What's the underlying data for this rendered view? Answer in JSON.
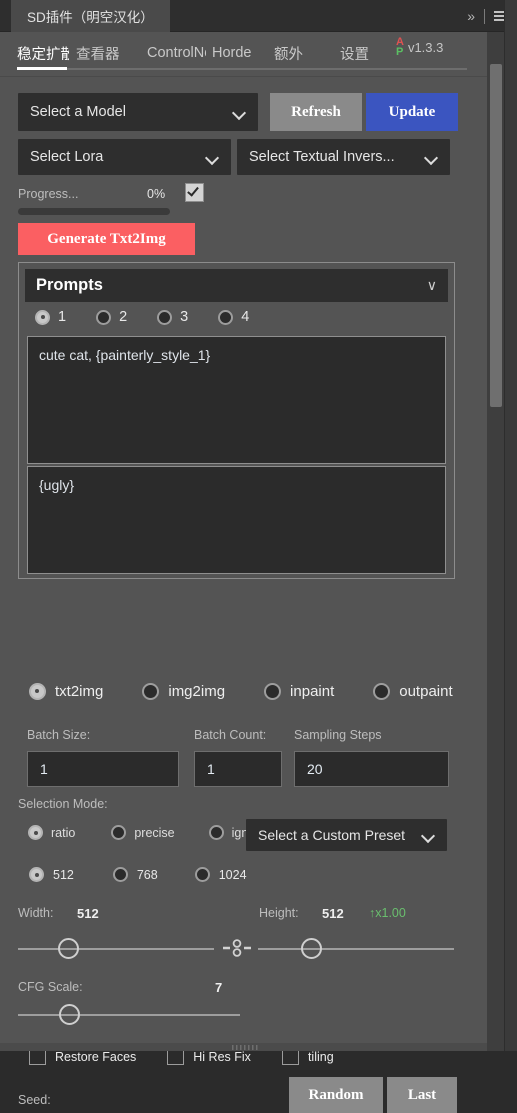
{
  "window": {
    "title": "SD插件（明空汉化）",
    "expand_icon": "chevron-double-right-icon",
    "menu_icon": "hamburger-icon"
  },
  "tabs": [
    {
      "label": "稳定扩散",
      "active": true
    },
    {
      "label": "查看器",
      "active": false
    },
    {
      "label": "ControlNet",
      "active": false
    },
    {
      "label": "Horde",
      "active": false
    },
    {
      "label": "额外",
      "active": false
    },
    {
      "label": "设置",
      "active": false
    }
  ],
  "version_badge": {
    "a": "A",
    "p": "P",
    "version": "v1.3.3",
    "a_color": "#e05252",
    "p_color": "#5bbf63",
    "collapse_icon": "chevron-up-icon"
  },
  "model_row": {
    "model_select": "Select a Model",
    "refresh_label": "Refresh",
    "update_label": "Update",
    "update_color": "#3b55c0"
  },
  "lora_row": {
    "lora_select": "Select Lora",
    "textual_inversion_select": "Select Textual Invers..."
  },
  "progress": {
    "label": "Progress...",
    "percent": "0%",
    "value": 0,
    "checkbox_checked": true
  },
  "generate": {
    "label": "Generate Txt2Img",
    "color": "#fb5f62"
  },
  "prompts": {
    "title": "Prompts",
    "collapse_icon": "chevron-down-icon",
    "slots": [
      {
        "label": "1",
        "selected": true
      },
      {
        "label": "2",
        "selected": false
      },
      {
        "label": "3",
        "selected": false
      },
      {
        "label": "4",
        "selected": false
      }
    ],
    "positive": "cute cat, {painterly_style_1}",
    "negative": "{ugly}"
  },
  "modes": [
    {
      "label": "txt2img",
      "selected": true
    },
    {
      "label": "img2img",
      "selected": false
    },
    {
      "label": "inpaint",
      "selected": false
    },
    {
      "label": "outpaint",
      "selected": false
    }
  ],
  "batch": {
    "batch_size_label": "Batch Size:",
    "batch_size_value": "1",
    "batch_count_label": "Batch Count:",
    "batch_count_value": "1",
    "sampling_steps_label": "Sampling Steps",
    "sampling_steps_value": "20"
  },
  "selection_mode": {
    "label": "Selection Mode:",
    "options": [
      {
        "label": "ratio",
        "selected": true
      },
      {
        "label": "precise",
        "selected": false
      },
      {
        "label": "ignore",
        "selected": false
      }
    ],
    "custom_preset": "Select a Custom Preset"
  },
  "resolution_presets": [
    {
      "label": "512",
      "selected": true
    },
    {
      "label": "768",
      "selected": false
    },
    {
      "label": "1024",
      "selected": false
    }
  ],
  "dimensions": {
    "width_label": "Width:",
    "width_value": "512",
    "height_label": "Height:",
    "height_value": "512",
    "scale_badge": "↑x1.00",
    "scale_badge_color": "#6abf6e",
    "link_icon": "link-chain-icon"
  },
  "cfg": {
    "label": "CFG Scale:",
    "value": "7"
  },
  "toggles": [
    {
      "label": "Restore Faces",
      "checked": false
    },
    {
      "label": "Hi Res Fix",
      "checked": false
    },
    {
      "label": "tiling",
      "checked": false
    }
  ],
  "seed": {
    "label": "Seed:",
    "value": "",
    "random_label": "Random",
    "last_label": "Last"
  }
}
